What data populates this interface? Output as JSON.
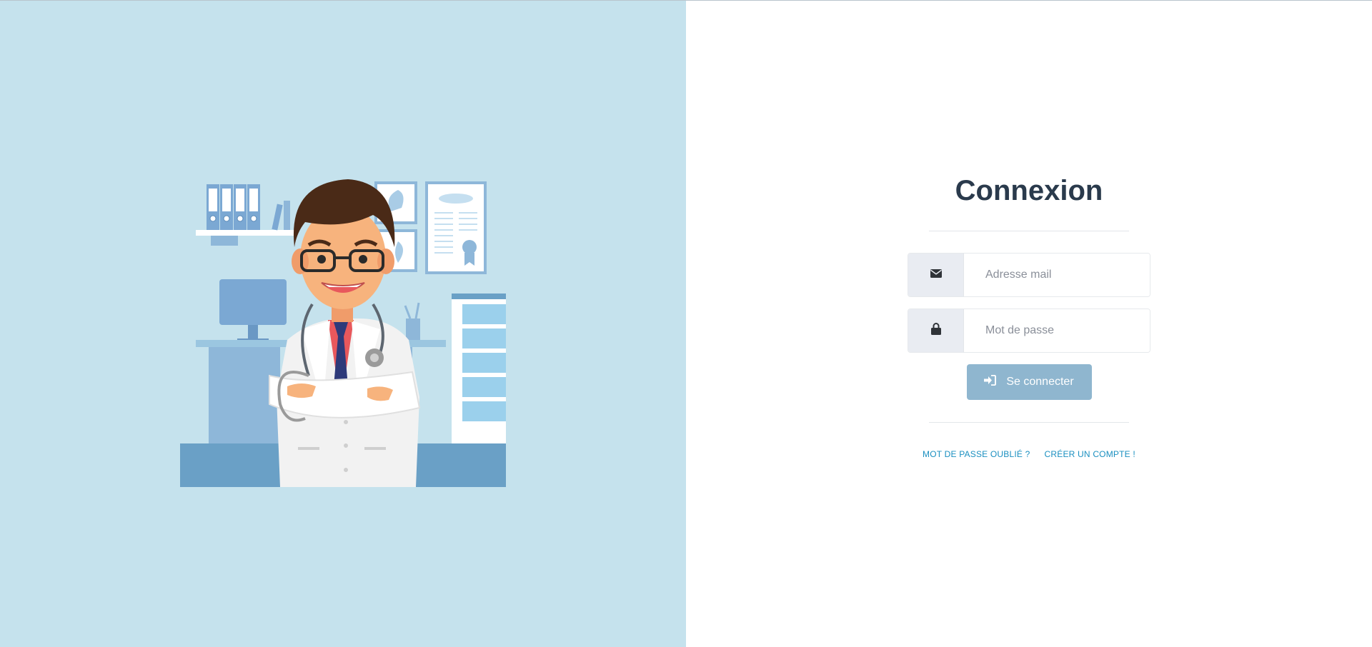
{
  "login": {
    "title": "Connexion",
    "email": {
      "placeholder": "Adresse mail",
      "icon": "envelope-icon"
    },
    "password": {
      "placeholder": "Mot de passe",
      "icon": "lock-icon"
    },
    "submit": {
      "label": "Se connecter",
      "icon": "sign-in-icon"
    },
    "links": {
      "forgot_password": "MOT DE PASSE OUBLIÉ ?",
      "create_account": "CRÉER UN COMPTE !"
    }
  },
  "colors": {
    "left_background": "#c5e2ed",
    "title": "#2a3a4c",
    "button": "#8fb6cf",
    "link": "#1a8fc0"
  }
}
